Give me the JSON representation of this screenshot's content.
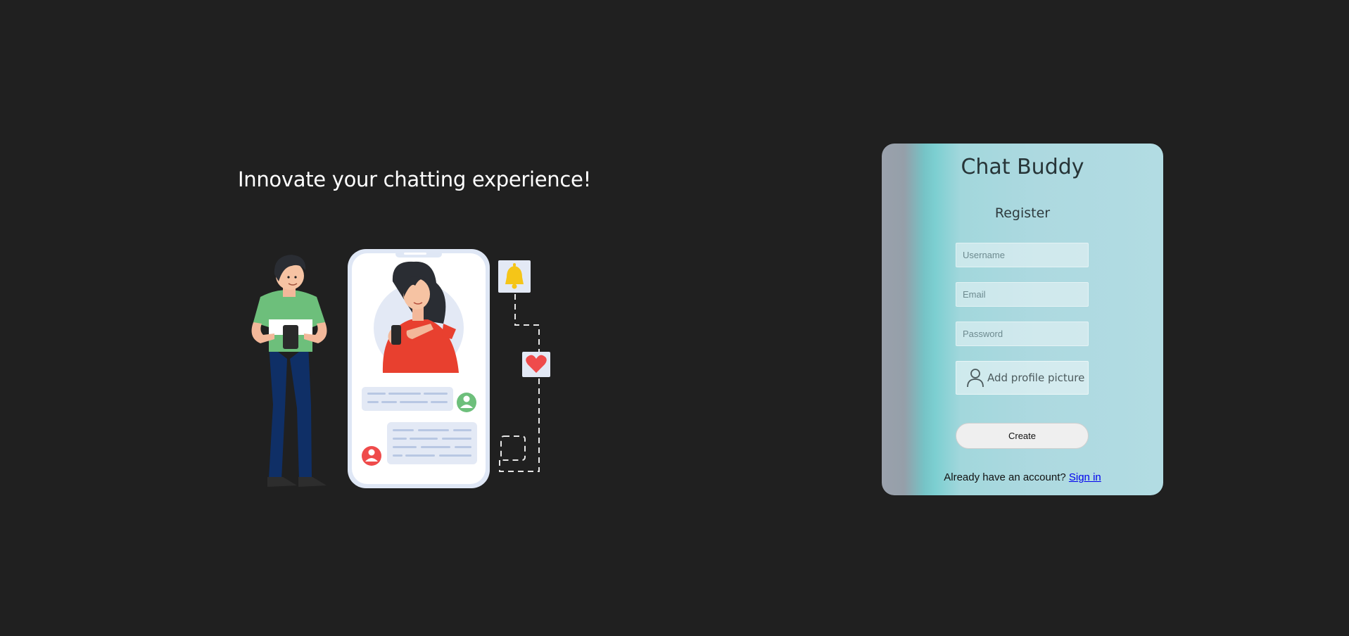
{
  "hero": {
    "title": "Innovate your chatting experience!"
  },
  "register_card": {
    "app_title": "Chat Buddy",
    "form_title": "Register",
    "username": {
      "value": "",
      "placeholder": "Username"
    },
    "email": {
      "value": "",
      "placeholder": "Email"
    },
    "password": {
      "value": "",
      "placeholder": "Password"
    },
    "avatar_upload": {
      "label": "Add profile picture",
      "icon": "user-outline-icon"
    },
    "create_label": "Create",
    "signin_prompt": "Already have an account?",
    "signin_link": "Sign in"
  },
  "colors": {
    "page_background": "#202020",
    "link": "#0000ee",
    "shirt_green": "#6dbf7b",
    "dress_red": "#e8402f",
    "bell_yellow": "#f5c518",
    "heart_red": "#ef4b4b"
  }
}
